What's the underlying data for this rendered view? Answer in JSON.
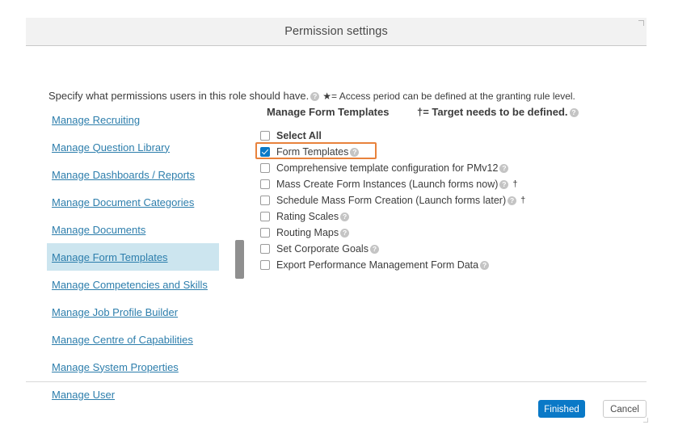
{
  "dialog": {
    "title": "Permission settings",
    "intro": {
      "text": "Specify what permissions users in this role should have.",
      "help_icon": "help-icon",
      "star_note": "★= Access period can be defined at the granting rule level."
    },
    "columns": {
      "left_header": "Manage Form Templates",
      "right_header": "†= Target needs to be defined.",
      "right_header_help_icon": "help-icon"
    },
    "nav_links": [
      {
        "label": "Manage Recruiting",
        "active": false
      },
      {
        "label": "Manage Question Library",
        "active": false
      },
      {
        "label": "Manage Dashboards / Reports",
        "active": false
      },
      {
        "label": "Manage Document Categories",
        "active": false
      },
      {
        "label": "Manage Documents",
        "active": false
      },
      {
        "label": "Manage Form Templates",
        "active": true
      },
      {
        "label": "Manage Competencies and Skills",
        "active": false
      },
      {
        "label": "Manage Job Profile Builder",
        "active": false
      },
      {
        "label": "Manage Centre of Capabilities",
        "active": false
      },
      {
        "label": "Manage System Properties",
        "active": false
      },
      {
        "label": "Manage User",
        "active": false
      }
    ],
    "permissions": [
      {
        "label": "Select All",
        "checked": false,
        "bold": true,
        "help": false,
        "dagger": false,
        "highlighted": false
      },
      {
        "label": "Form Templates",
        "checked": true,
        "bold": false,
        "help": true,
        "dagger": false,
        "highlighted": true
      },
      {
        "label": "Comprehensive template configuration for PMv12",
        "checked": false,
        "bold": false,
        "help": true,
        "dagger": false,
        "highlighted": false
      },
      {
        "label": "Mass Create Form Instances (Launch forms now)",
        "checked": false,
        "bold": false,
        "help": true,
        "dagger": true,
        "highlighted": false
      },
      {
        "label": "Schedule Mass Form Creation (Launch forms later)",
        "checked": false,
        "bold": false,
        "help": true,
        "dagger": true,
        "highlighted": false
      },
      {
        "label": "Rating Scales",
        "checked": false,
        "bold": false,
        "help": true,
        "dagger": false,
        "highlighted": false
      },
      {
        "label": "Routing Maps",
        "checked": false,
        "bold": false,
        "help": true,
        "dagger": false,
        "highlighted": false
      },
      {
        "label": "Set Corporate Goals",
        "checked": false,
        "bold": false,
        "help": true,
        "dagger": false,
        "highlighted": false
      },
      {
        "label": "Export Performance Management Form Data",
        "checked": false,
        "bold": false,
        "help": true,
        "dagger": false,
        "highlighted": false
      }
    ],
    "footer": {
      "finished_label": "Finished",
      "cancel_label": "Cancel"
    },
    "colors": {
      "link": "#2d7eac",
      "active_row_bg": "#cce5ef",
      "primary_button": "#0a79c7",
      "highlight_border": "#e8823c",
      "title_bar_bg": "#f2f2f2",
      "scroll_thumb": "#8f8f8f"
    },
    "symbols": {
      "dagger": "†",
      "star": "★"
    }
  }
}
